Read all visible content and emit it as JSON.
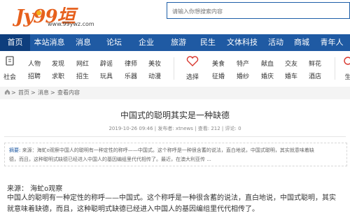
{
  "logo": {
    "prefix": "J",
    "text": "y",
    "number": "99",
    "han": "垣",
    "url": "www.99ywz.com"
  },
  "search": {
    "placeholder": "请输入你想搜索内容"
  },
  "nav": [
    "首页",
    "本站消息",
    "消息",
    "论坛",
    "企业",
    "旅游",
    "民生",
    "文体科技",
    "活动",
    "商城",
    "青年人",
    "老"
  ],
  "subnav": {
    "cat1": {
      "label": "社会",
      "links": [
        [
          "人物",
          "发现",
          "网红",
          "辟谣",
          "律师",
          "美妆"
        ],
        [
          "招聘",
          "求职",
          "招生",
          "玩具",
          "乐器",
          "动漫"
        ]
      ]
    },
    "cat2": {
      "label": "选择",
      "links": [
        [
          "美食",
          "特产",
          "献血",
          "交友",
          "鲜花"
        ],
        [
          "征婚",
          "婚纱",
          "婚庆",
          "婚车",
          "酒店"
        ]
      ]
    },
    "cat3": {
      "label": "生"
    }
  },
  "breadcrumb": {
    "home": "首页",
    "sep": ">",
    "level1": "消息",
    "level2": "查看内容"
  },
  "article": {
    "title": "中国式的聪明其实是一种缺德",
    "meta": "2019-10-26 09:46 | 发布者: xtnews | 查看: 212 | 评论: 0",
    "summary_label": "摘要:",
    "summary_line1": "来源：海虻o观察中国人的聪明有一种定性的称呼——中国式。这个称呼是一种很含蓄的说法，直白地说，中国式聪明，其实就意味着缺",
    "summary_line2": "德，而且，这种聪明式缺德已经进入中国人的基因编组里代代相传了。最近，在澳大利亚传 ...",
    "source": "来源：   海虻o观察",
    "body_line1": "中国人的聪明有一种定性的称呼——中国式。这个称呼是一种很含蓄的说法，直白地说，中国式聪明，其实",
    "body_line2": "就意味着缺德，而且，这种聪明式缺德已经进入中国人的基因编组里代代相传了。"
  },
  "colors": {
    "brand_orange": "#e6601d",
    "nav_blue": "#1f5aa3",
    "nav_active": "#0e3e7d"
  }
}
